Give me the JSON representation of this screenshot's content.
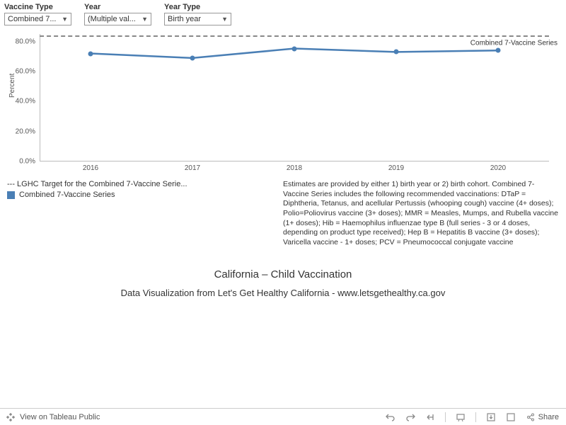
{
  "filters": {
    "vaccine_type": {
      "label": "Vaccine Type",
      "value": "Combined 7..."
    },
    "year": {
      "label": "Year",
      "value": "(Multiple val..."
    },
    "year_type": {
      "label": "Year Type",
      "value": "Birth year"
    }
  },
  "chart_data": {
    "type": "line",
    "ylabel": "Percent",
    "ylim": [
      0,
      85
    ],
    "yticks": [
      "0.0%",
      "20.0%",
      "40.0%",
      "60.0%",
      "80.0%"
    ],
    "categories": [
      "2016",
      "2017",
      "2018",
      "2019",
      "2020"
    ],
    "series": [
      {
        "name": "Combined 7-Vaccine Series",
        "values": [
          72.0,
          69.0,
          75.3,
          73.0,
          74.0
        ]
      }
    ],
    "target": {
      "name": "LGHC Target for the Combined 7-Vaccine Series",
      "value": 84.0
    },
    "series_label_inline": "Combined 7-Vaccine Series"
  },
  "legend": {
    "target_text": "--- LGHC Target for the Combined 7-Vaccine Serie...",
    "series_text": "Combined 7-Vaccine Series"
  },
  "description": "Estimates are provided by either 1) birth year or 2) birth cohort. Combined 7-Vaccine Series includes the following recommended vaccinations: DTaP = Diphtheria, Tetanus, and acellular Pertussis (whooping cough) vaccine (4+ doses); Polio=Poliovirus vaccine (3+ doses); MMR = Measles, Mumps, and Rubella vaccine (1+ doses); Hib = Haemophilus influenzae type B (full series - 3 or 4 doses, depending on product type received); Hep B = Hepatitis B vaccine (3+ doses); Varicella vaccine - 1+ doses; PCV = Pneumococcal conjugate vaccine",
  "titles": {
    "main": "California – Child Vaccination",
    "sub": "Data Visualization from Let's Get Healthy California - www.letsgethealthy.ca.gov"
  },
  "toolbar": {
    "view_label": "View on Tableau Public",
    "share_label": "Share"
  }
}
